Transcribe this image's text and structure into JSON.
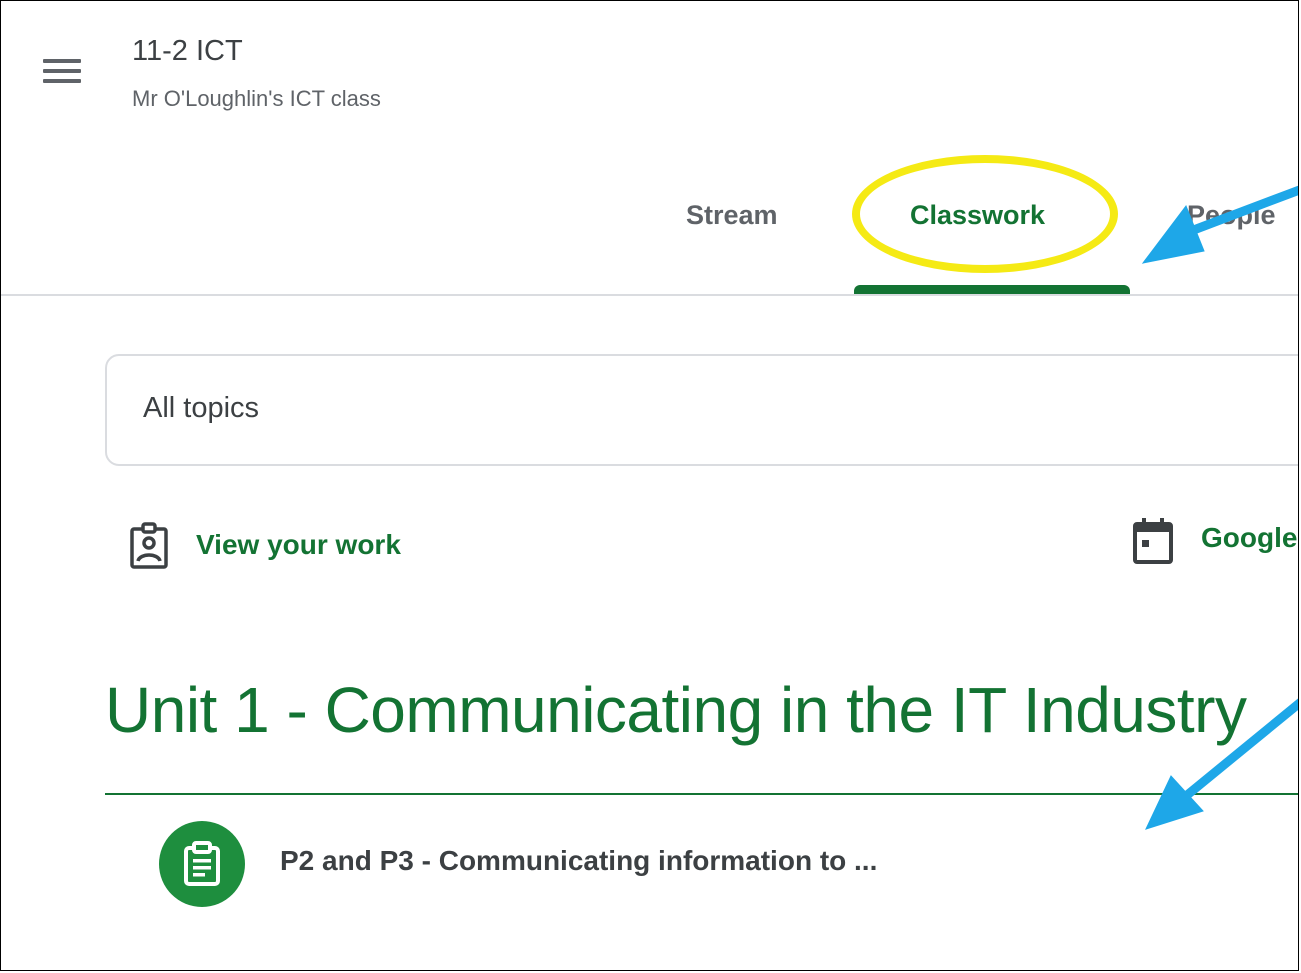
{
  "header": {
    "menu_icon": "hamburger-menu-icon",
    "class_name": "11-2 ICT",
    "class_subtitle": "Mr O'Loughlin's ICT class"
  },
  "tabs": [
    {
      "label": "Stream",
      "active": false
    },
    {
      "label": "Classwork",
      "active": true
    },
    {
      "label": "People",
      "active": false
    }
  ],
  "filter": {
    "selected": "All topics"
  },
  "links": {
    "view_work": {
      "label": "View your work",
      "icon": "assignment-ind-icon"
    },
    "calendar": {
      "label": "Google Calendar",
      "icon": "calendar-icon"
    }
  },
  "topic": {
    "title": "Unit 1 - Communicating in the IT Industry"
  },
  "assignments": [
    {
      "title": "P2 and P3 - Communicating information to ...",
      "icon": "assignment-icon"
    }
  ],
  "colors": {
    "accent_green": "#137333",
    "icon_green": "#1e8e3e",
    "highlight_yellow": "#f5ea14",
    "arrow_blue": "#1ea7e8",
    "divider_grey": "#dadce0"
  }
}
